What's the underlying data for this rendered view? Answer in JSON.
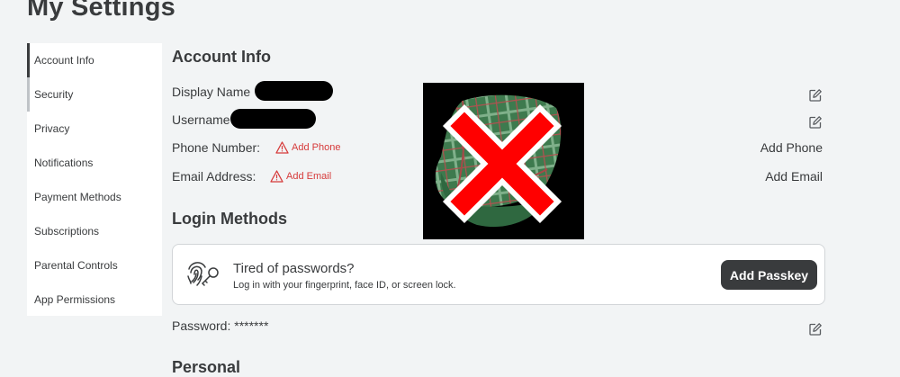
{
  "page": {
    "title": "My Settings"
  },
  "sidebar": {
    "items": [
      {
        "label": "Account Info",
        "state": "active"
      },
      {
        "label": "Security",
        "state": "hover"
      },
      {
        "label": "Privacy",
        "state": "normal"
      },
      {
        "label": "Notifications",
        "state": "normal"
      },
      {
        "label": "Payment Methods",
        "state": "normal"
      },
      {
        "label": "Subscriptions",
        "state": "normal"
      },
      {
        "label": "Parental Controls",
        "state": "normal"
      },
      {
        "label": "App Permissions",
        "state": "normal"
      }
    ]
  },
  "account_info": {
    "title": "Account Info",
    "display_name_label": "Display Name",
    "username_label": "Username",
    "phone_label": "Phone Number:",
    "phone_warning": "Add Phone",
    "phone_action": "Add Phone",
    "email_label": "Email Address:",
    "email_warning": "Add Email",
    "email_action": "Add Email"
  },
  "login_methods": {
    "title": "Login Methods",
    "passkey_title": "Tired of passwords?",
    "passkey_subtitle": "Log in with your fingerprint, face ID, or screen lock.",
    "passkey_button": "Add Passkey",
    "password_label": "Password: *******"
  },
  "personal": {
    "title": "Personal"
  },
  "colors": {
    "accent_dark": "#393b3d",
    "warning_red": "#d63a3a",
    "page_bg": "#f2f4f5",
    "card_bg": "#ffffff"
  },
  "icons": [
    "pencil-edit-icon",
    "warning-triangle-icon",
    "fingerprint-key-icon"
  ]
}
